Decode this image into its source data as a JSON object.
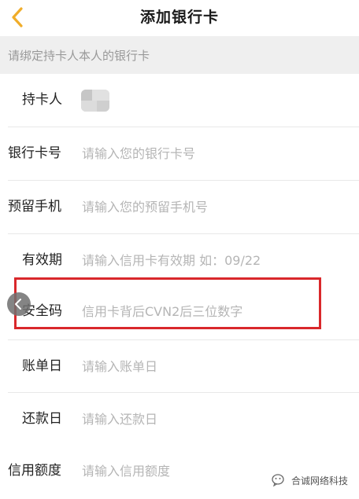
{
  "colors": {
    "accent": "#f0ad2a",
    "highlight": "#d9282b",
    "placeholder": "#b5b5b5",
    "hint_bg": "#efefef"
  },
  "header": {
    "title": "添加银行卡",
    "back_icon": "chevron-left-icon"
  },
  "hint": "请绑定持卡人本人的银行卡",
  "form": {
    "cardholder": {
      "label": "持卡人"
    },
    "card_number": {
      "label": "银行卡号",
      "placeholder": "请输入您的银行卡号"
    },
    "phone": {
      "label": "预留手机",
      "placeholder": "请输入您的预留手机号"
    },
    "expiry": {
      "label": "有效期",
      "placeholder": "请输入信用卡有效期 如：09/22"
    },
    "cvn": {
      "label": "安全码",
      "placeholder": "信用卡背后CVN2后三位数字"
    },
    "statement_day": {
      "label": "账单日",
      "placeholder": "请输入账单日"
    },
    "repay_day": {
      "label": "还款日",
      "placeholder": "请输入还款日"
    },
    "credit_limit": {
      "label": "信用额度",
      "placeholder": "请输入信用额度"
    }
  },
  "watermark": {
    "text": "合诚网络科技",
    "icon": "wechat-official-account-icon"
  }
}
